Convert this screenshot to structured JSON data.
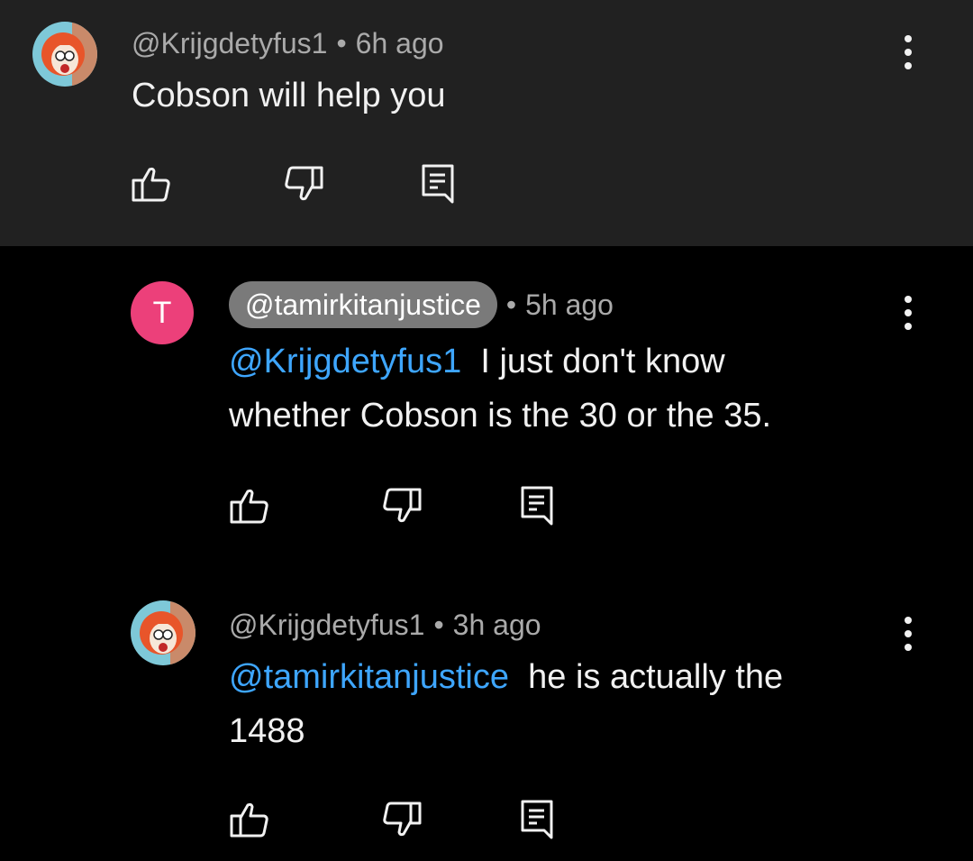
{
  "comments": [
    {
      "author": "@Krijgdetyfus1",
      "time": "6h ago",
      "text": "Cobson will help you",
      "avatar_icon": "cartoon-avatar-icon"
    }
  ],
  "replies": [
    {
      "author": "@tamirkitanjustice",
      "author_highlighted": true,
      "time": "5h ago",
      "avatar_letter": "T",
      "avatar_color": "#ec407a",
      "mention": "@Krijgdetyfus1",
      "text_line1": "I just don't know",
      "text_line2": "whether Cobson is the 30 or the 35."
    },
    {
      "author": "@Krijgdetyfus1",
      "time": "3h ago",
      "avatar_icon": "cartoon-avatar-icon",
      "mention": "@tamirkitanjustice",
      "text_line1": "he is actually the",
      "text_line2": "1488"
    }
  ],
  "separator": "•",
  "icons": {
    "like": "thumbs-up-icon",
    "dislike": "thumbs-down-icon",
    "reply": "reply-comment-icon",
    "more": "more-vertical-icon"
  },
  "colors": {
    "parent_background": "#212121",
    "page_background": "#000000",
    "mention": "#3ea6ff",
    "meta": "#aaaaaa",
    "author_pill": "#7a7a7a"
  }
}
